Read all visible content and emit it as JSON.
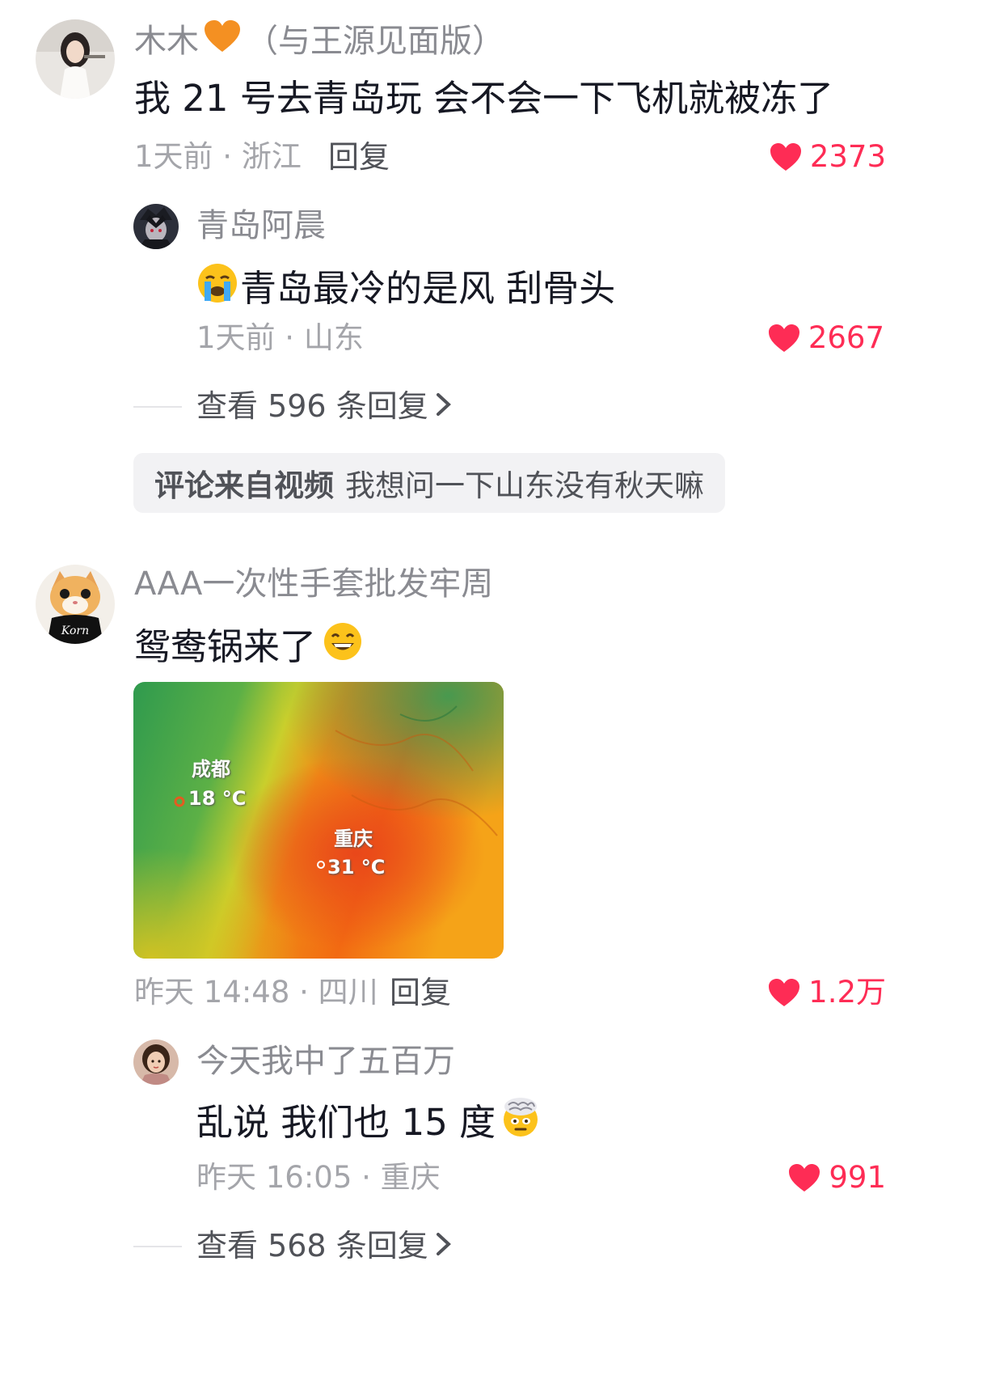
{
  "colors": {
    "like": "#fe2c55",
    "username": "#8a8b91",
    "meta": "#a4a5aa",
    "text": "#161823",
    "chip_bg": "#f2f2f4"
  },
  "comments": [
    {
      "username": "木木",
      "username_suffix": "（与王源见面版）",
      "badge_icon": "orange-heart-icon",
      "text": "我 21 号去青岛玩 会不会一下飞机就被冻了",
      "meta": "1天前 · 浙江",
      "reply_label": "回复",
      "likes": "2373",
      "sub_reply": {
        "username": "青岛阿晨",
        "emoji": "crying-face-emoji",
        "text": "青岛最冷的是风 刮骨头",
        "meta": "1天前 · 山东",
        "likes": "2667"
      },
      "view_more": "查看 596 条回复",
      "source": {
        "label": "评论来自视频",
        "title": "我想问一下山东没有秋天嘛"
      }
    },
    {
      "username": "AAA一次性手套批发牢周",
      "text": "鸳鸯锅来了",
      "emoji": "grinning-face-emoji",
      "image": {
        "labels": [
          {
            "city": "成都",
            "temp": "18 °C"
          },
          {
            "city": "重庆",
            "temp": "31 °C"
          }
        ]
      },
      "meta": "昨天 14:48 · 四川",
      "reply_label": "回复",
      "likes": "1.2万",
      "sub_reply": {
        "username": "今天我中了五百万",
        "text": "乱说 我们也 15 度",
        "emoji": "exploding-head-emoji",
        "meta": "昨天 16:05 · 重庆",
        "likes": "991"
      },
      "view_more": "查看 568 条回复"
    }
  ]
}
